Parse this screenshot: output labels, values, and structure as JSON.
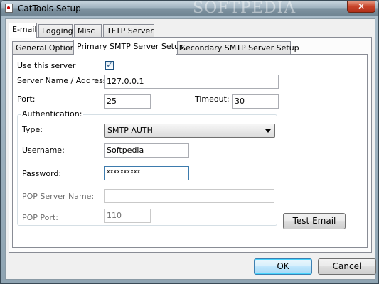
{
  "window": {
    "title": "CatTools Setup",
    "watermark": "SOFTPEDIA",
    "close_glyph": "✕"
  },
  "tabs": [
    {
      "label": "E-mail",
      "active": true
    },
    {
      "label": "Logging",
      "active": false
    },
    {
      "label": "Misc",
      "active": false
    },
    {
      "label": "TFTP Server",
      "active": false
    }
  ],
  "subtabs": [
    {
      "label": "General Options",
      "active": false
    },
    {
      "label": "Primary SMTP Server Setup",
      "active": true
    },
    {
      "label": "Secondary SMTP Server Setup",
      "active": false
    }
  ],
  "form": {
    "use_server_label": "Use this server",
    "use_server_checked": true,
    "check_glyph": "✓",
    "server_name_label": "Server Name / Address:",
    "server_name_value": "127.0.0.1",
    "port_label": "Port:",
    "port_value": "25",
    "timeout_label": "Timeout:",
    "timeout_value": "30",
    "auth_group_label": "Authentication:",
    "type_label": "Type:",
    "type_value": "SMTP AUTH",
    "username_label": "Username:",
    "username_value": "Softpedia",
    "password_label": "Password:",
    "password_value": "xxxxxxxxxx",
    "pop_server_label": "POP Server Name:",
    "pop_server_value": "",
    "pop_port_label": "POP Port:",
    "pop_port_value": "110"
  },
  "buttons": {
    "test_email": "Test Email",
    "ok": "OK",
    "cancel": "Cancel"
  }
}
